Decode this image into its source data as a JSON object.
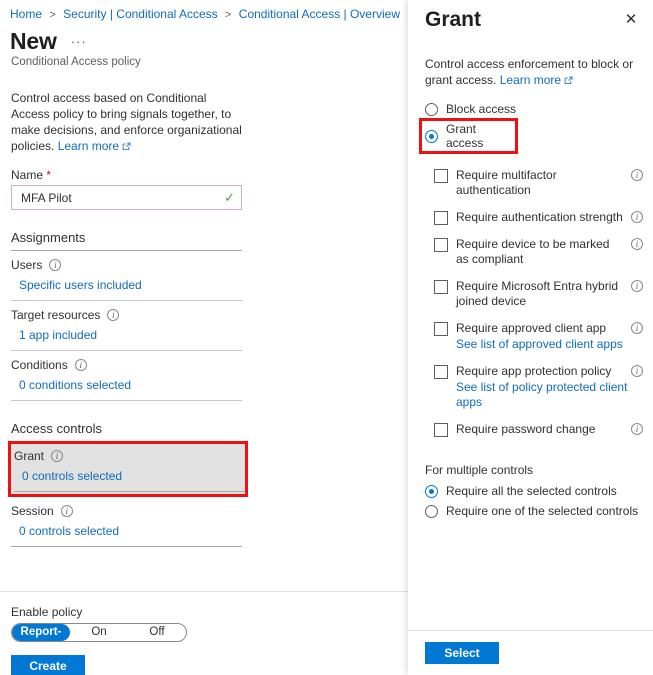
{
  "breadcrumb": {
    "items": [
      "Home",
      "Security | Conditional Access",
      "Conditional Access | Overview"
    ],
    "separator": ">"
  },
  "left": {
    "page_title": "New",
    "ellipsis": "···",
    "subtitle": "Conditional Access policy",
    "description": "Control access based on Conditional Access policy to bring signals together, to make decisions, and enforce organizational policies.",
    "learn_more": "Learn more",
    "name_label": "Name",
    "required_marker": "*",
    "name_value": "MFA Pilot",
    "name_placeholder": "Name",
    "assignments_heading": "Assignments",
    "assignment_rows": [
      {
        "label": "Users",
        "value": "Specific users included"
      },
      {
        "label": "Target resources",
        "value": "1 app included"
      },
      {
        "label": "Conditions",
        "value": "0 conditions selected"
      }
    ],
    "access_controls_heading": "Access controls",
    "grant": {
      "label": "Grant",
      "value": "0 controls selected"
    },
    "session": {
      "label": "Session",
      "value": "0 controls selected"
    },
    "enable_policy_label": "Enable policy",
    "enable_policy_options": [
      "Report-only",
      "On",
      "Off"
    ],
    "enable_policy_selected": "Report-only",
    "create_button": "Create"
  },
  "panel": {
    "title": "Grant",
    "close_label": "✕",
    "description": "Control access enforcement to block or grant access.",
    "learn_more": "Learn more",
    "access_options": [
      {
        "label": "Block access",
        "selected": false
      },
      {
        "label": "Grant access",
        "selected": true
      }
    ],
    "controls": [
      {
        "label": "Require multifactor authentication",
        "checked": false,
        "sub_link": ""
      },
      {
        "label": "Require authentication strength",
        "checked": false,
        "sub_link": ""
      },
      {
        "label": "Require device to be marked as compliant",
        "checked": false,
        "sub_link": ""
      },
      {
        "label": "Require Microsoft Entra hybrid joined device",
        "checked": false,
        "sub_link": ""
      },
      {
        "label": "Require approved client app",
        "checked": false,
        "sub_link": "See list of approved client apps"
      },
      {
        "label": "Require app protection policy",
        "checked": false,
        "sub_link": "See list of policy protected client apps"
      },
      {
        "label": "Require password change",
        "checked": false,
        "sub_link": ""
      }
    ],
    "multiple_controls_heading": "For multiple controls",
    "multiple_controls_options": [
      {
        "label": "Require all the selected controls",
        "selected": true
      },
      {
        "label": "Require one of the selected controls",
        "selected": false
      }
    ],
    "select_button": "Select"
  },
  "colors": {
    "accent": "#0078d4",
    "link": "#0f6cbd",
    "annotation": "#ee1111",
    "highlight_bg": "#e1e1e1",
    "valid_check": "#4b9b4b"
  }
}
